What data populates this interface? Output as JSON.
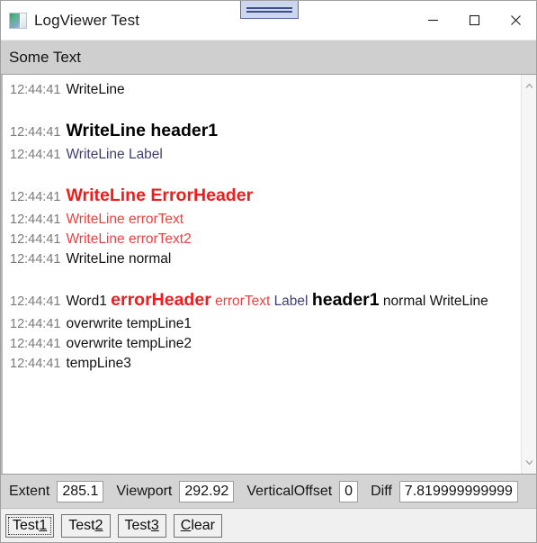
{
  "window": {
    "title": "LogViewer Test",
    "icon": "app-logo-icon",
    "controls": {
      "minimize": "minimize-icon",
      "maximize": "maximize-icon",
      "close": "close-icon"
    },
    "dock_indicator": "snap-layout-indicator"
  },
  "subheader": {
    "text": "Some Text"
  },
  "log": {
    "lines": [
      {
        "timestamp": "12:44:41",
        "spaced": false,
        "big": false,
        "segments": [
          {
            "text": "WriteLine",
            "style": "normal"
          }
        ]
      },
      {
        "timestamp": "12:44:41",
        "spaced": true,
        "big": true,
        "segments": [
          {
            "text": "WriteLine header1",
            "style": "header"
          }
        ]
      },
      {
        "timestamp": "12:44:41",
        "spaced": false,
        "big": false,
        "segments": [
          {
            "text": "WriteLine Label",
            "style": "label"
          }
        ]
      },
      {
        "timestamp": "12:44:41",
        "spaced": true,
        "big": true,
        "segments": [
          {
            "text": "WriteLine ErrorHeader",
            "style": "errorheader"
          }
        ]
      },
      {
        "timestamp": "12:44:41",
        "spaced": false,
        "big": false,
        "segments": [
          {
            "text": "WriteLine errorText",
            "style": "errortext"
          }
        ]
      },
      {
        "timestamp": "12:44:41",
        "spaced": false,
        "big": false,
        "segments": [
          {
            "text": "WriteLine errorText2",
            "style": "errortext"
          }
        ]
      },
      {
        "timestamp": "12:44:41",
        "spaced": false,
        "big": false,
        "segments": [
          {
            "text": "WriteLine normal",
            "style": "normal"
          }
        ]
      },
      {
        "timestamp": "12:44:41",
        "spaced": true,
        "big": true,
        "segments": [
          {
            "text": "Word1 ",
            "style": "normal"
          },
          {
            "text": "errorHeader",
            "style": "errorheader"
          },
          {
            "text": " ",
            "style": "normal"
          },
          {
            "text": "errorText",
            "style": "errortext"
          },
          {
            "text": " ",
            "style": "normal"
          },
          {
            "text": "Label",
            "style": "label"
          },
          {
            "text": " ",
            "style": "normal"
          },
          {
            "text": "header1",
            "style": "header"
          },
          {
            "text": " normal WriteLine",
            "style": "normal"
          }
        ]
      },
      {
        "timestamp": "12:44:41",
        "spaced": false,
        "big": false,
        "segments": [
          {
            "text": "overwrite tempLine1",
            "style": "normal"
          }
        ]
      },
      {
        "timestamp": "12:44:41",
        "spaced": false,
        "big": false,
        "segments": [
          {
            "text": "overwrite tempLine2",
            "style": "normal"
          }
        ]
      },
      {
        "timestamp": "12:44:41",
        "spaced": false,
        "big": false,
        "segments": [
          {
            "text": "tempLine3",
            "style": "normal"
          }
        ]
      }
    ]
  },
  "scrollbar": {
    "up_icon": "chevron-up-icon",
    "down_icon": "chevron-down-icon"
  },
  "status": {
    "fields": [
      {
        "label": "Extent",
        "value": "285.1",
        "name": "extent"
      },
      {
        "label": "Viewport",
        "value": "292.92",
        "name": "viewport"
      },
      {
        "label": "VerticalOffset",
        "value": "0",
        "name": "vertical-offset"
      },
      {
        "label": "Diff",
        "value": "7.819999999999",
        "name": "diff"
      }
    ]
  },
  "buttons": [
    {
      "prefix": "Test",
      "accesskey": "1",
      "suffix": "",
      "name": "test1",
      "focused": true
    },
    {
      "prefix": "Test",
      "accesskey": "2",
      "suffix": "",
      "name": "test2",
      "focused": false
    },
    {
      "prefix": "Test",
      "accesskey": "3",
      "suffix": "",
      "name": "test3",
      "focused": false
    },
    {
      "prefix": "",
      "accesskey": "C",
      "suffix": "lear",
      "name": "clear",
      "focused": false
    }
  ],
  "colors": {
    "error": "#ef1c1c",
    "error_text": "#ef4040",
    "label": "#3f3f73",
    "timestamp": "#7b7b7b",
    "normal": "#111111"
  }
}
